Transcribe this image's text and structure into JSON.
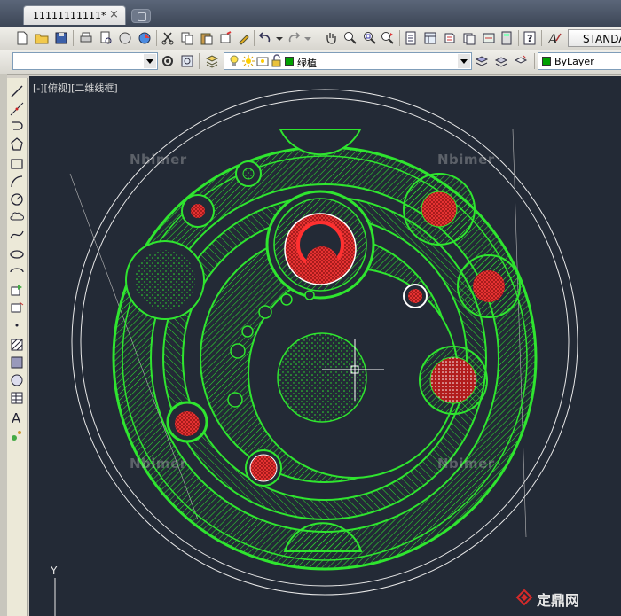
{
  "document_tab": {
    "title": "11111111111*",
    "close": "×"
  },
  "toolbar": {
    "text_style": "STANDA"
  },
  "layers": {
    "workspace_value": "",
    "current_layer": "绿植",
    "layer_color": "#00a000",
    "color_control": "ByLayer",
    "color_swatch": "#00a000"
  },
  "viewport": {
    "label": "[-][俯视][二维线框]",
    "background": "#232a36",
    "axis_label": "Y"
  },
  "watermarks": [
    "Nbimer",
    "Nbimer",
    "Nbimer",
    "Nbimer"
  ],
  "brand": {
    "text": "定鼎网"
  },
  "drawing_colors": {
    "green": "#2fe52f",
    "white": "#e8e8e8",
    "red": "#e02020",
    "darkred": "#7a1414"
  }
}
